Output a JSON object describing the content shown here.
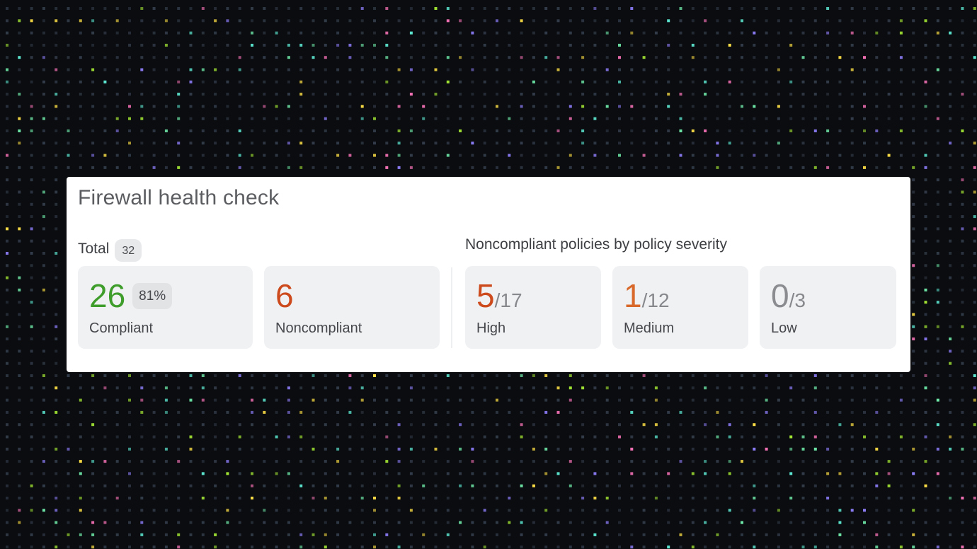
{
  "widget": {
    "title": "Firewall health check",
    "total_label": "Total",
    "total_count": "32",
    "severity_heading": "Noncompliant policies by policy severity"
  },
  "compliance": {
    "compliant": {
      "value": "26",
      "percent": "81%",
      "label": "Compliant",
      "color": "#3f9d2c"
    },
    "noncompliant": {
      "value": "6",
      "label": "Noncompliant",
      "color": "#cd4a1d"
    }
  },
  "severity": [
    {
      "value": "5",
      "of": "/17",
      "label": "High",
      "color": "#cd4a1d"
    },
    {
      "value": "1",
      "of": "/12",
      "label": "Medium",
      "color": "#d8692a"
    },
    {
      "value": "0",
      "of": "/3",
      "label": "Low",
      "color": "#8a8c90"
    }
  ],
  "background": {
    "dot_colors": [
      "#6ee7a8",
      "#8b7cf6",
      "#f472b6",
      "#fde047",
      "#5eead4",
      "#a3e635",
      "#475569"
    ]
  }
}
